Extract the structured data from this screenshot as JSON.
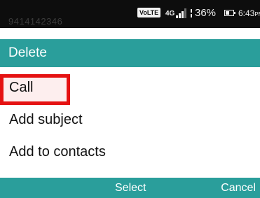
{
  "status_bar": {
    "background_peek": "9414142346",
    "volte_badge": "VoLTE",
    "network_type": "4G",
    "battery_percent": "36%",
    "time": "6:43",
    "time_suffix": "PM"
  },
  "dialog": {
    "title": "Delete",
    "accent_color": "#2a9e9b",
    "items": [
      {
        "label": "Call",
        "selected": true
      },
      {
        "label": "Add subject",
        "selected": false
      },
      {
        "label": "Add to contacts",
        "selected": false
      }
    ]
  },
  "softkeys": {
    "center": "Select",
    "right": "Cancel"
  },
  "highlight_color": "#e51212"
}
